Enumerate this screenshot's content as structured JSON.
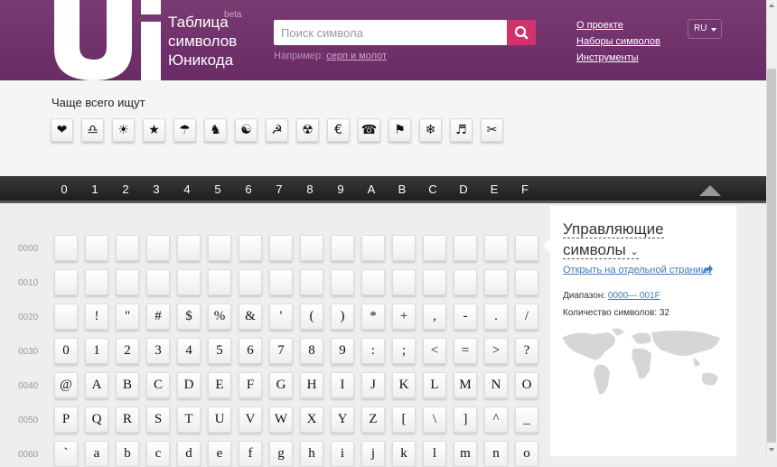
{
  "header": {
    "logo_title_line1": "Таблица",
    "logo_title_line2": "символов",
    "logo_title_line3": "Юникода",
    "beta": "beta",
    "search_placeholder": "Поиск символа",
    "example_prefix": "Например:",
    "example_link": "серп и молот",
    "nav": [
      "О проекте",
      "Наборы символов",
      "Инструменты"
    ],
    "lang": "RU"
  },
  "popular": {
    "title": "Чаще всего ищут",
    "symbols": [
      "❤",
      "♎",
      "☀",
      "★",
      "☂",
      "♞",
      "☯",
      "☭",
      "☢",
      "€",
      "☎",
      "⚑",
      "❄",
      "♬",
      "✂"
    ]
  },
  "hex_columns": [
    "0",
    "1",
    "2",
    "3",
    "4",
    "5",
    "6",
    "7",
    "8",
    "9",
    "A",
    "B",
    "C",
    "D",
    "E",
    "F"
  ],
  "grid": {
    "rows": [
      {
        "label": "0000",
        "chars": [
          "",
          "",
          "",
          "",
          "",
          "",
          "",
          "",
          "",
          "",
          "",
          "",
          "",
          "",
          "",
          ""
        ]
      },
      {
        "label": "0010",
        "chars": [
          "",
          "",
          "",
          "",
          "",
          "",
          "",
          "",
          "",
          "",
          "",
          "",
          "",
          "",
          "",
          ""
        ]
      },
      {
        "label": "0020",
        "chars": [
          "",
          "!",
          "\"",
          "#",
          "$",
          "%",
          "&",
          "'",
          "(",
          ")",
          "*",
          "+",
          ",",
          "-",
          ".",
          "/"
        ]
      },
      {
        "label": "0030",
        "chars": [
          "0",
          "1",
          "2",
          "3",
          "4",
          "5",
          "6",
          "7",
          "8",
          "9",
          ":",
          ";",
          "<",
          "=",
          ">",
          "?"
        ]
      },
      {
        "label": "0040",
        "chars": [
          "@",
          "A",
          "B",
          "C",
          "D",
          "E",
          "F",
          "G",
          "H",
          "I",
          "J",
          "K",
          "L",
          "M",
          "N",
          "O"
        ]
      },
      {
        "label": "0050",
        "chars": [
          "P",
          "Q",
          "R",
          "S",
          "T",
          "U",
          "V",
          "W",
          "X",
          "Y",
          "Z",
          "[",
          "\\",
          "]",
          "^",
          "_"
        ]
      },
      {
        "label": "0060",
        "chars": [
          "`",
          "a",
          "b",
          "c",
          "d",
          "e",
          "f",
          "g",
          "h",
          "i",
          "j",
          "k",
          "l",
          "m",
          "n",
          "o"
        ]
      }
    ]
  },
  "panel": {
    "title_line1": "Управляющие",
    "title_line2": "символы",
    "open_link": "Открыть на отдельной странице",
    "range_label": "Диапазон:",
    "range_value": "0000— 001F",
    "count_label": "Количество символов:",
    "count_value": "32"
  },
  "colors": {
    "header": "#6f2f6b",
    "search_button": "#d0336c",
    "link": "#3c7ab8",
    "hexbar": "#2a2a2a"
  }
}
